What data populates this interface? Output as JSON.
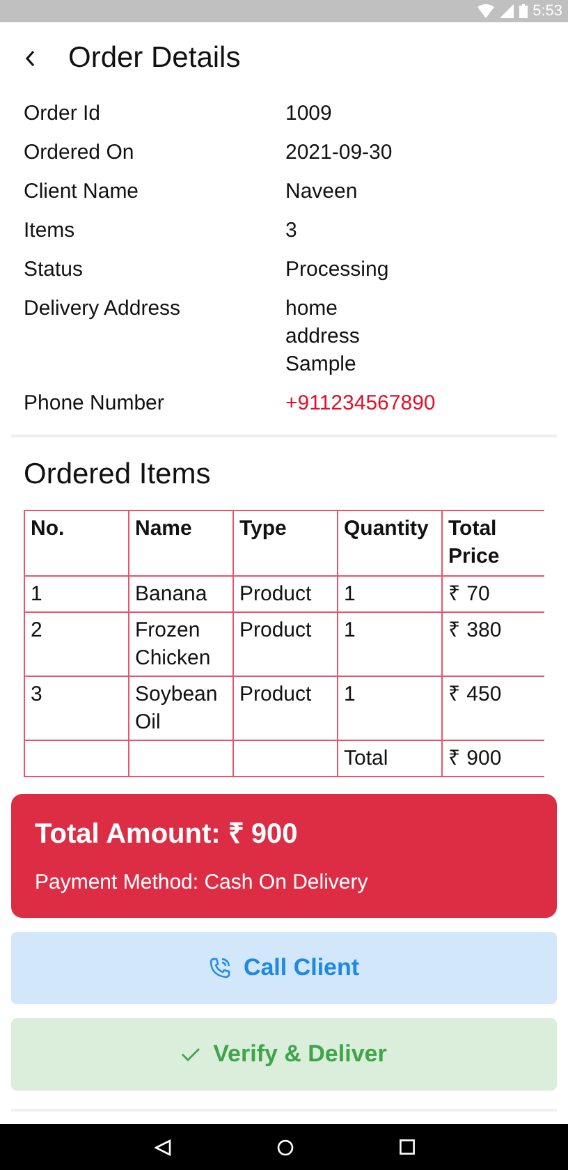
{
  "status_bar": {
    "time": "5:53"
  },
  "header": {
    "title": "Order Details"
  },
  "details": [
    {
      "label": "Order Id",
      "value": "1009",
      "kind": "plain"
    },
    {
      "label": "Ordered On",
      "value": "2021-09-30",
      "kind": "plain"
    },
    {
      "label": "Client Name",
      "value": "Naveen",
      "kind": "plain"
    },
    {
      "label": "Items",
      "value": "3",
      "kind": "plain"
    },
    {
      "label": "Status",
      "value": "Processing",
      "kind": "plain"
    },
    {
      "label": "Delivery Address",
      "value": "home address Sample",
      "kind": "address"
    },
    {
      "label": "Phone Number",
      "value": "+911234567890",
      "kind": "phone"
    }
  ],
  "items_section": {
    "title": "Ordered Items",
    "table": {
      "columns": [
        "No.",
        "Name",
        "Type",
        "Quantity",
        "Total Price"
      ],
      "rows": [
        [
          "1",
          "Banana",
          "Product",
          "1",
          "₹ 70"
        ],
        [
          "2",
          "Frozen Chicken",
          "Product",
          "1",
          "₹ 380"
        ],
        [
          "3",
          "Soybean Oil",
          "Product",
          "1",
          "₹ 450"
        ],
        [
          "",
          "",
          "",
          "Total",
          "₹ 900"
        ]
      ]
    }
  },
  "summary": {
    "total": "Total Amount: ₹ 900",
    "payment": "Payment Method: Cash On Delivery"
  },
  "buttons": [
    {
      "label": "Call Client",
      "kind": "call"
    },
    {
      "label": "Verify & Deliver",
      "kind": "verify"
    }
  ]
}
